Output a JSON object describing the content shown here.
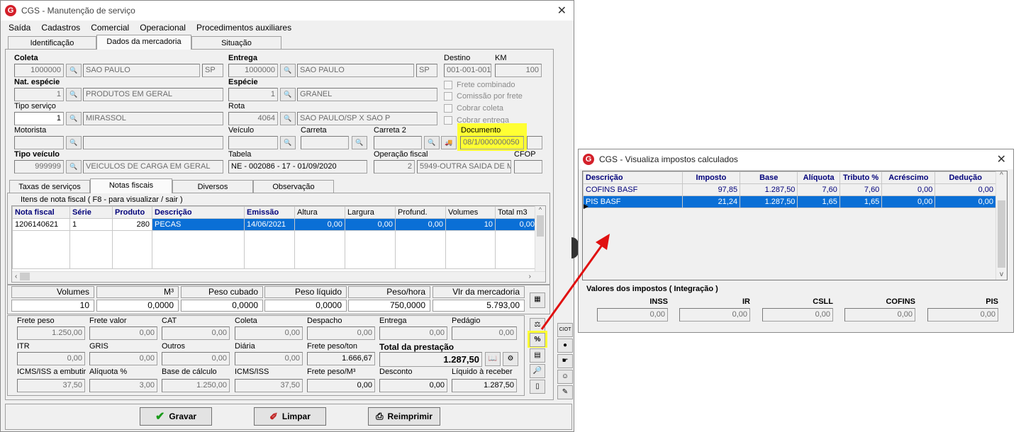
{
  "main": {
    "title": "CGS - Manutenção de serviço",
    "menu": [
      "Saída",
      "Cadastros",
      "Comercial",
      "Operacional",
      "Procedimentos auxiliares"
    ],
    "tabs": [
      "Identificação",
      "Dados da mercadoria",
      "Situação"
    ],
    "coleta": {
      "label": "Coleta",
      "code": "1000000",
      "city": "SAO PAULO",
      "uf": "SP"
    },
    "entrega": {
      "label": "Entrega",
      "code": "1000000",
      "city": "SAO PAULO",
      "uf": "SP"
    },
    "destino": {
      "label": "Destino",
      "value": "001-001-001"
    },
    "km": {
      "label": "KM",
      "value": "100"
    },
    "nat_especie": {
      "label": "Nat. espécie",
      "code": "1",
      "desc": "PRODUTOS EM GERAL"
    },
    "especie": {
      "label": "Espécie",
      "code": "1",
      "desc": "GRANEL"
    },
    "tipo_servico": {
      "label": "Tipo serviço",
      "code": "1",
      "desc": "MIRASSOL"
    },
    "rota": {
      "label": "Rota",
      "code": "4064",
      "desc": "SAO PAULO/SP X SAO P"
    },
    "checkboxes": [
      "Frete combinado",
      "Comissão por frete",
      "Cobrar coleta",
      "Cobrar entrega"
    ],
    "motorista": {
      "label": "Motorista"
    },
    "veiculo": {
      "label": "Veículo"
    },
    "carreta": {
      "label": "Carreta"
    },
    "carreta2": {
      "label": "Carreta 2"
    },
    "documento": {
      "label": "Documento",
      "value": "08/1/000000050"
    },
    "tipo_veiculo": {
      "label": "Tipo veículo",
      "code": "999999",
      "desc": "VEICULOS DE CARGA EM GERAL"
    },
    "tabela": {
      "label": "Tabela",
      "value": "NE - 002086 - 17 - 01/09/2020"
    },
    "operacao_fiscal": {
      "label": "Operação fiscal",
      "code": "2",
      "desc": "5949-OUTRA SAIDA DE M"
    },
    "cfop": {
      "label": "CFOP"
    },
    "subtabs": [
      "Taxas de serviços",
      "Notas fiscais",
      "Diversos",
      "Observação"
    ],
    "nf_group_label": "Itens de nota fiscal ( F8 - para visualizar / sair )",
    "nf_headers": [
      "Nota fiscal",
      "Série",
      "Produto",
      "Descrição",
      "Emissão",
      "Altura",
      "Largura",
      "Profund.",
      "Volumes",
      "Total m3"
    ],
    "nf_rows": [
      [
        "1206140621",
        "1",
        "280",
        "PECAS",
        "14/06/2021",
        "0,00",
        "0,00",
        "0,00",
        "10",
        "0,00"
      ]
    ],
    "summary_headers": [
      "Volumes",
      "M³",
      "Peso cubado",
      "Peso líquido",
      "Peso/hora",
      "Vlr da mercadoria"
    ],
    "summary_values": [
      "10",
      "0,0000",
      "0,0000",
      "0,0000",
      "750,0000",
      "5.793,00"
    ],
    "frete": {
      "row1": [
        [
          "Frete peso",
          "1.250,00"
        ],
        [
          "Frete valor",
          "0,00"
        ],
        [
          "CAT",
          "0,00"
        ],
        [
          "Coleta",
          "0,00"
        ],
        [
          "Despacho",
          "0,00"
        ],
        [
          "Entrega",
          "0,00"
        ],
        [
          "Pedágio",
          "0,00"
        ]
      ],
      "row2": [
        [
          "ITR",
          "0,00"
        ],
        [
          "GRIS",
          "0,00"
        ],
        [
          "Outros",
          "0,00"
        ],
        [
          "Diária",
          "0,00"
        ],
        [
          "Frete peso/ton",
          "1.666,67"
        ]
      ],
      "total_label": "Total da prestação",
      "total_value": "1.287,50",
      "row3": [
        [
          "ICMS/ISS a embutir",
          "37,50"
        ],
        [
          "Alíquota %",
          "3,00"
        ],
        [
          "Base de cálculo",
          "1.250,00"
        ],
        [
          "ICMS/ISS",
          "37,50"
        ],
        [
          "Frete peso/M³",
          "0,00"
        ],
        [
          "Desconto",
          "0,00"
        ],
        [
          "Líquido à receber",
          "1.287,50"
        ]
      ]
    },
    "buttons": {
      "gravar": "Gravar",
      "limpar": "Limpar",
      "reimprimir": "Reimprimir"
    }
  },
  "tax": {
    "title": "CGS - Visualiza impostos calculados",
    "headers": [
      "Descrição",
      "Imposto",
      "Base",
      "Alíquota",
      "Tributo %",
      "Acréscimo",
      "Dedução"
    ],
    "rows": [
      [
        "COFINS BASF",
        "97,85",
        "1.287,50",
        "7,60",
        "7,60",
        "0,00",
        "0,00"
      ],
      [
        "PIS BASF",
        "21,24",
        "1.287,50",
        "1,65",
        "1,65",
        "0,00",
        "0,00"
      ]
    ],
    "values_label": "Valores dos impostos ( Integração )",
    "value_fields": [
      [
        "INSS",
        "0,00"
      ],
      [
        "IR",
        "0,00"
      ],
      [
        "CSLL",
        "0,00"
      ],
      [
        "COFINS",
        "0,00"
      ],
      [
        "PIS",
        "0,00"
      ]
    ]
  },
  "colors": {
    "highlight": "#ffff33",
    "selection": "#0a6fd6",
    "arrow": "#e01010",
    "logo": "#d4202a"
  }
}
